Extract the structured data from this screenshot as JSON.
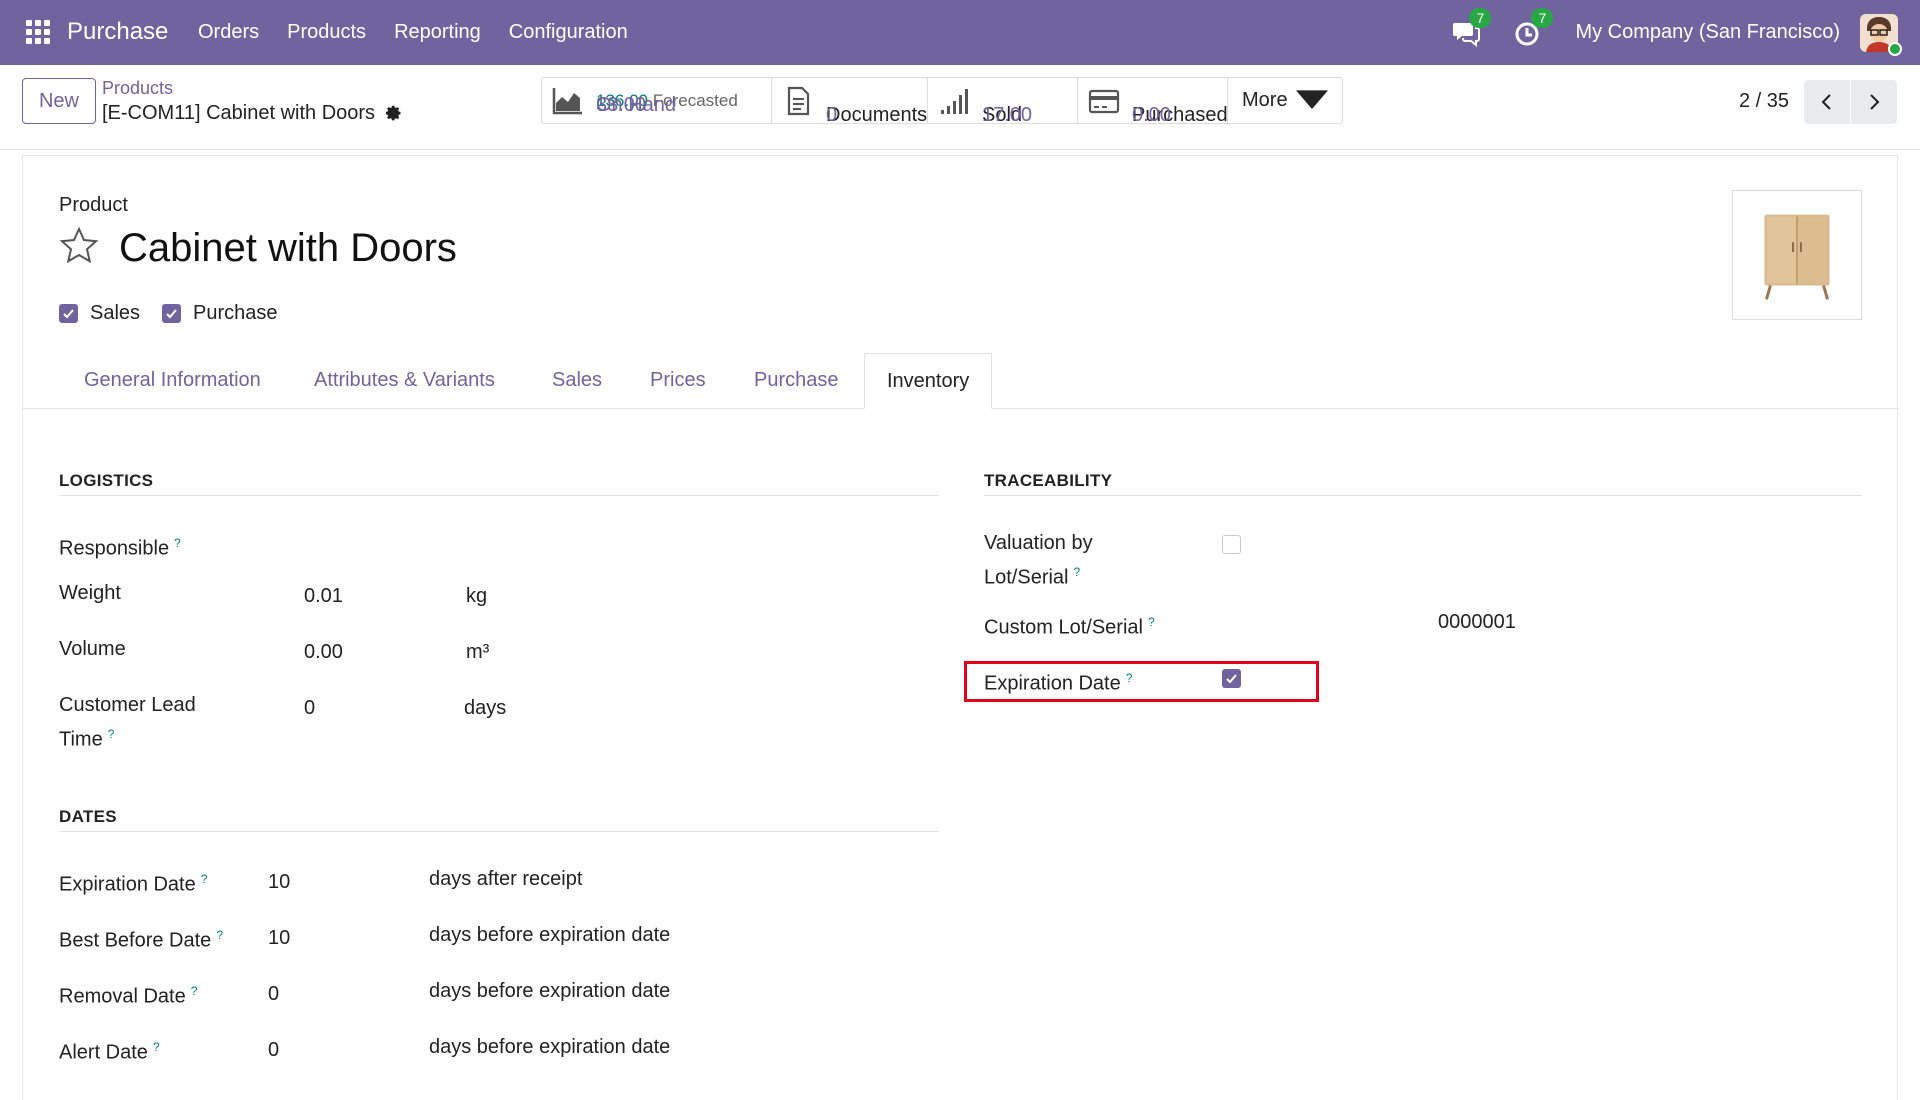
{
  "navbar": {
    "app_name": "Purchase",
    "menu": [
      "Orders",
      "Products",
      "Reporting",
      "Configuration"
    ],
    "messages_count": "7",
    "activities_count": "7",
    "company": "My Company (San Francisco)"
  },
  "control": {
    "new_label": "New",
    "breadcrumb_parent": "Products",
    "breadcrumb_current": "[E-COM11] Cabinet with Doors",
    "stats": {
      "on_hand_value": "33.00",
      "on_hand_label": "On Hand",
      "forecast_value": "136.00",
      "forecast_label": "Forecasted",
      "documents_label": "Documents",
      "documents_value": "0",
      "sold_label": "Sold",
      "sold_value": "17.00",
      "purchased_label": "Purchased",
      "purchased_value": "0.00",
      "more_label": "More"
    },
    "pager": "2 / 35"
  },
  "form": {
    "type_label": "Product",
    "name": "Cabinet with Doors",
    "sales_label": "Sales",
    "purchase_label": "Purchase",
    "tabs": [
      "General Information",
      "Attributes & Variants",
      "Sales",
      "Prices",
      "Purchase",
      "Inventory"
    ],
    "active_tab": "Inventory",
    "logistics": {
      "heading": "LOGISTICS",
      "responsible_label": "Responsible",
      "weight_label": "Weight",
      "weight_value": "0.01",
      "weight_unit": "kg",
      "volume_label": "Volume",
      "volume_value": "0.00",
      "volume_unit": "m³",
      "lead_label_1": "Customer Lead",
      "lead_label_2": "Time",
      "lead_value": "0",
      "lead_unit": "days"
    },
    "traceability": {
      "heading": "TRACEABILITY",
      "valuation_label_1": "Valuation by",
      "valuation_label_2": "Lot/Serial",
      "custom_lot_label": "Custom Lot/Serial",
      "custom_lot_value": "0000001",
      "expiration_label": "Expiration Date"
    },
    "dates": {
      "heading": "DATES",
      "expiration_label": "Expiration Date",
      "expiration_value": "10",
      "expiration_unit": "days after receipt",
      "best_before_label": "Best Before Date",
      "best_before_value": "10",
      "best_before_unit": "days before expiration date",
      "removal_label": "Removal Date",
      "removal_value": "0",
      "removal_unit": "days before expiration date",
      "alert_label": "Alert Date",
      "alert_value": "0",
      "alert_unit": "days before expiration date"
    },
    "help_mark": "?"
  },
  "colors": {
    "brand": "#71639e",
    "teal": "#017e84",
    "badge": "#28a745",
    "highlight": "#e3001b"
  }
}
